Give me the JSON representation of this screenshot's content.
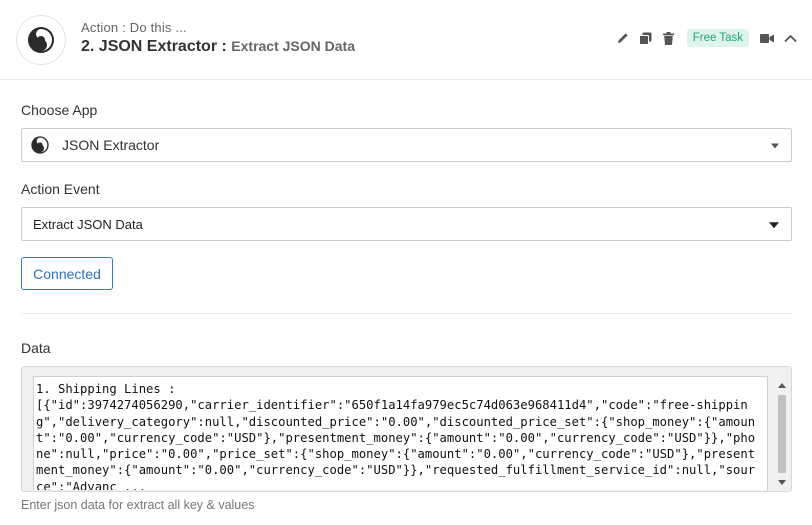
{
  "header": {
    "subtitle": "Action : Do this ...",
    "step_title": "2. JSON Extractor :",
    "event_name": "Extract JSON Data",
    "badge": "Free Task",
    "icons": [
      "pencil-icon",
      "copy-icon",
      "trash-icon",
      "video-icon",
      "chevron-up-icon"
    ],
    "badge_bg": "#dcf4ec",
    "badge_color": "#22a27a"
  },
  "form": {
    "choose_app_label": "Choose App",
    "app_value": "JSON Extractor",
    "action_event_label": "Action Event",
    "action_event_value": "Extract JSON Data",
    "connected_label": "Connected",
    "data_label": "Data",
    "data_value": "1. Shipping Lines :\n[{\"id\":3974274056290,\"carrier_identifier\":\"650f1a14fa979ec5c74d063e968411d4\",\"code\":\"free-shipping\",\"delivery_category\":null,\"discounted_price\":\"0.00\",\"discounted_price_set\":{\"shop_money\":{\"amount\":\"0.00\",\"currency_code\":\"USD\"},\"presentment_money\":{\"amount\":\"0.00\",\"currency_code\":\"USD\"}},\"phone\":null,\"price\":\"0.00\",\"price_set\":{\"shop_money\":{\"amount\":\"0.00\",\"currency_code\":\"USD\"},\"presentment_money\":{\"amount\":\"0.00\",\"currency_code\":\"USD\"}},\"requested_fulfillment_service_id\":null,\"source\":\"Advanc ...",
    "helper_text": "Enter json data for extract all key & values",
    "accent_color": "#3b78c2"
  }
}
